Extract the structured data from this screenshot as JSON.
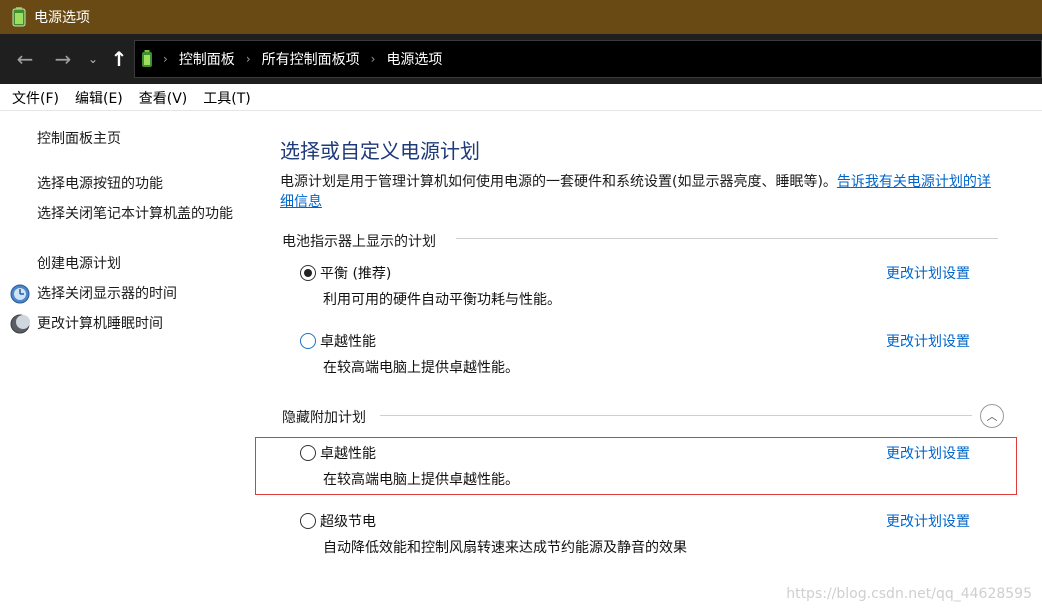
{
  "window": {
    "title": "电源选项"
  },
  "nav": {
    "back_glyph": "←",
    "forward_glyph": "→",
    "recent_glyph": "⌄",
    "up_glyph": "↑",
    "breadcrumb": [
      "控制面板",
      "所有控制面板项",
      "电源选项"
    ],
    "separator": "›"
  },
  "menu": [
    "文件(F)",
    "编辑(E)",
    "查看(V)",
    "工具(T)"
  ],
  "sidebar": {
    "home": "控制面板主页",
    "links": [
      "选择电源按钮的功能",
      "选择关闭笔记本计算机盖的功能",
      "创建电源计划",
      "选择关闭显示器的时间",
      "更改计算机睡眠时间"
    ],
    "icons": [
      "display-icon",
      "sleep-icon"
    ]
  },
  "main": {
    "heading": "选择或自定义电源计划",
    "description": "电源计划是用于管理计算机如何使用电源的一套硬件和系统设置(如显示器亮度、睡眠等)。",
    "description_link": "告诉我有关电源计划的详细信息",
    "battery_section": "电池指示器上显示的计划",
    "hidden_section": "隐藏附加计划",
    "change_link": "更改计划设置",
    "plans": [
      {
        "name": "平衡 (推荐)",
        "desc": "利用可用的硬件自动平衡功耗与性能。",
        "selected": true
      },
      {
        "name": "卓越性能",
        "desc": "在较高端电脑上提供卓越性能。",
        "selected": false
      },
      {
        "name": "卓越性能",
        "desc": "在较高端电脑上提供卓越性能。",
        "selected": false
      },
      {
        "name": "超级节电",
        "desc": "自动降低效能和控制风扇转速来达成节约能源及静音的效果",
        "selected": false
      }
    ],
    "collapse_glyph": "︿"
  },
  "watermark": "https://blog.csdn.net/qq_44628595",
  "colors": {
    "titlebar": "#6a4a14",
    "link": "#0066cc",
    "heading": "#1e3a78",
    "highlight": "#e03a3a"
  }
}
